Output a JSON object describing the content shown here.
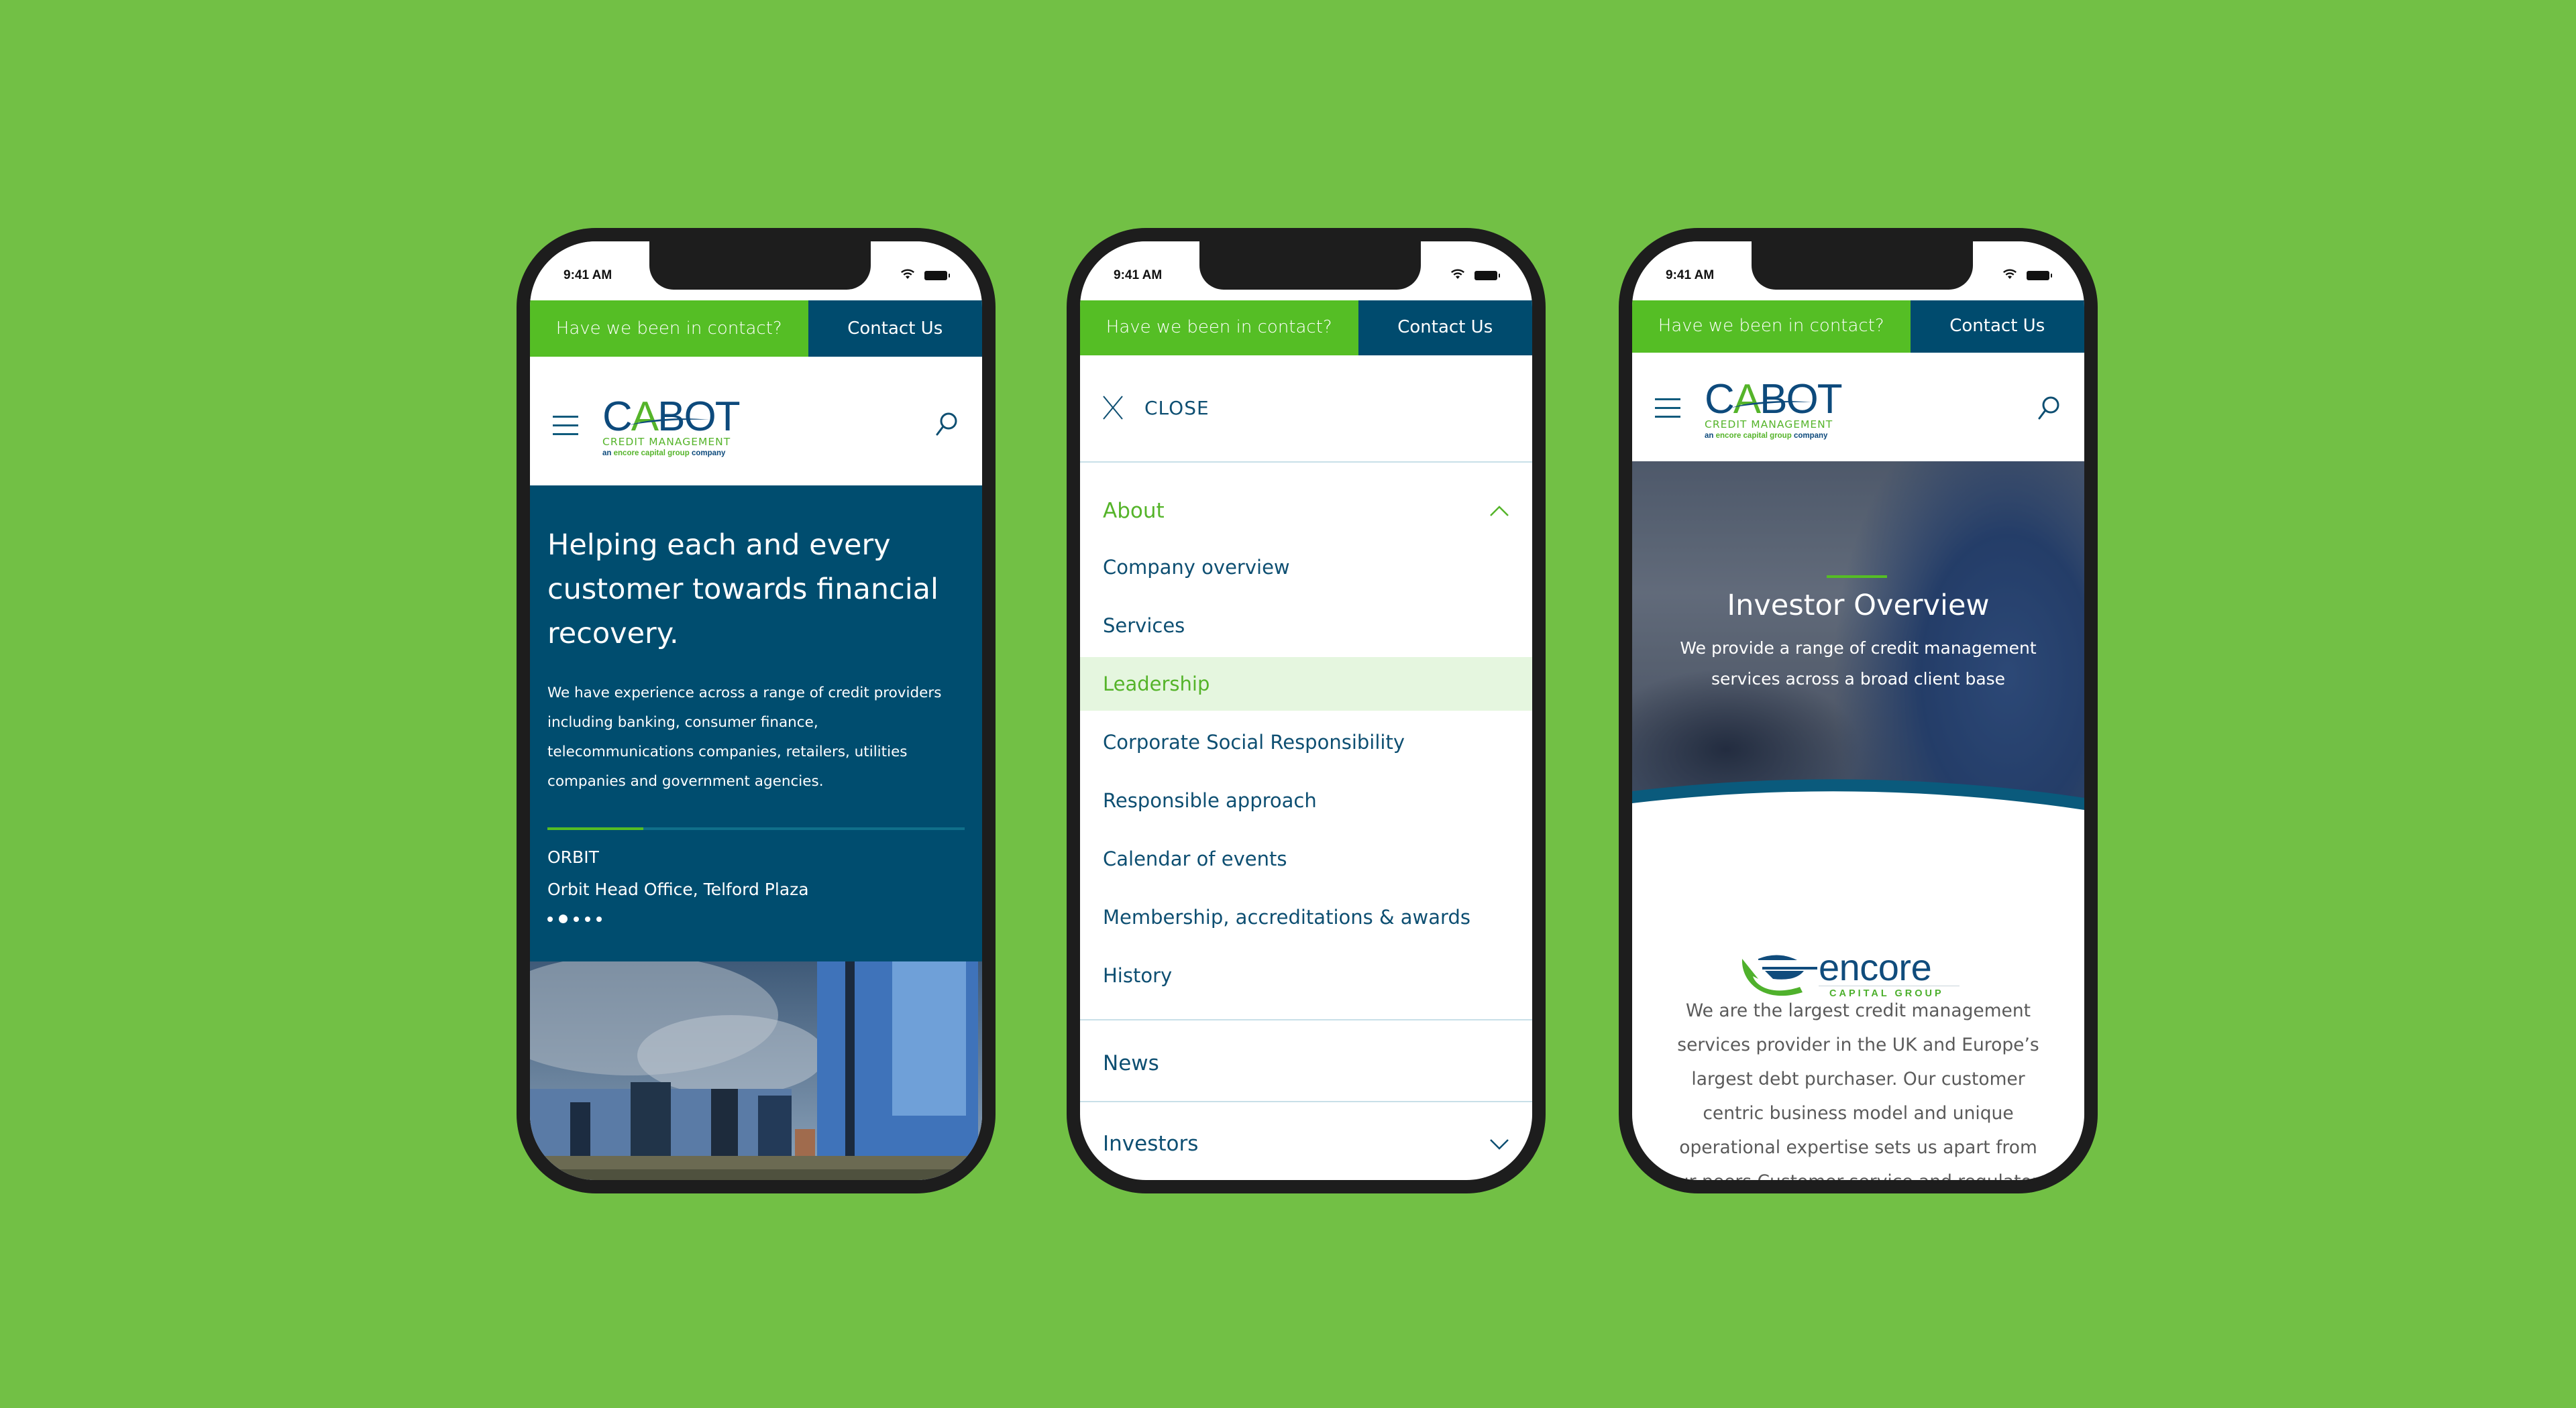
{
  "background_color": "#72c045",
  "colors": {
    "brand_green": "#55be25",
    "brand_navy": "#004b6e",
    "menu_text": "#0e4f72",
    "menu_highlight": "#e5f6df"
  },
  "status_bar": {
    "time": "9:41 AM",
    "wifi_icon": "wifi-icon",
    "battery_icon": "battery-icon"
  },
  "contact_bar": {
    "prompt": "Have we been in contact?",
    "contact_label": "Contact Us"
  },
  "logo": {
    "brand_c": "C",
    "brand_a": "A",
    "brand_rest": "BOT",
    "subtitle": "CREDIT MANAGEMENT",
    "tag_an": "an",
    "tag_group": "encore capital group",
    "tag_company": "company"
  },
  "icons": {
    "menu": "hamburger-icon",
    "search": "search-icon",
    "close": "close-icon",
    "expand": "chevron-down-icon",
    "collapse": "chevron-up-icon"
  },
  "home": {
    "headline": "Helping each and every customer towards financial recovery.",
    "body": "We have experience across a range of credit providers including banking, consumer finance, telecommunications companies, retailers, utilities companies and government agencies.",
    "slide_progress": 0.23,
    "location_title": "ORBIT",
    "location_subtitle": "Orbit Head Office, Telford Plaza",
    "carousel": {
      "total": 5,
      "active_index": 1
    },
    "image_alt": "office-buildings-photo"
  },
  "menu": {
    "close_label": "CLOSE",
    "sections": [
      {
        "label": "About",
        "expanded": true,
        "items": [
          {
            "label": "Company overview",
            "active": false
          },
          {
            "label": "Services",
            "active": false
          },
          {
            "label": "Leadership",
            "active": true
          },
          {
            "label": "Corporate Social Responsibility",
            "active": false
          },
          {
            "label": "Responsible approach",
            "active": false
          },
          {
            "label": "Calendar of events",
            "active": false
          },
          {
            "label": "Membership, accreditations & awards",
            "active": false
          },
          {
            "label": "History",
            "active": false
          }
        ]
      },
      {
        "label": "News",
        "expanded": false,
        "items": []
      },
      {
        "label": "Investors",
        "expanded": false,
        "items": []
      }
    ]
  },
  "investors": {
    "title": "Investor Overview",
    "subtitle": "We provide a range of credit management services across a broad client base",
    "partner_logo": {
      "name": "encore",
      "tagline": "CAPITAL GROUP"
    },
    "body": "We are the largest credit management services provider in the UK and Europe’s largest debt purchaser. Our customer centric business model and unique operational expertise sets us apart from our peers.Customer service and regulatory",
    "body_lines": [
      "We are the largest credit management",
      "services provider in the UK and Europe’s",
      "largest debt purchaser. Our customer",
      "centric business model and unique",
      "operational expertise sets us apart from",
      "our peers.Customer service and regulatory"
    ]
  }
}
